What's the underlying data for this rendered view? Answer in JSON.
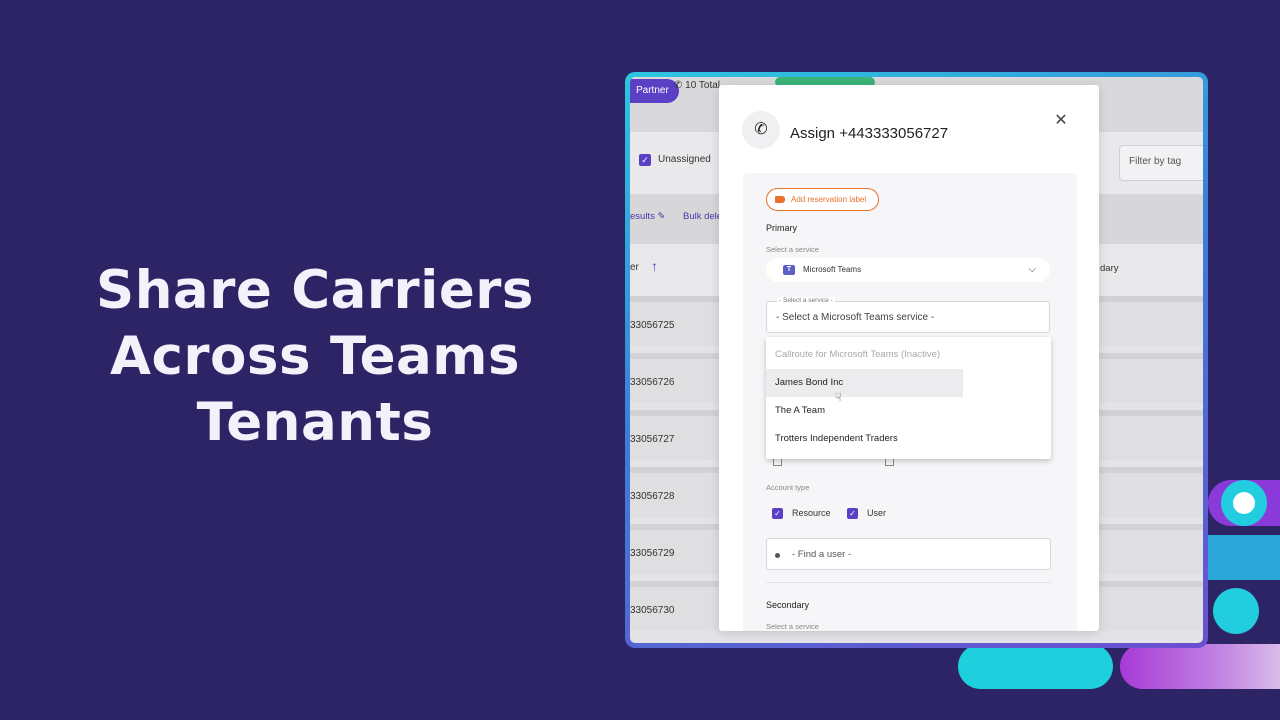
{
  "headline": [
    "Share Carriers",
    "Across Teams",
    "Tenants"
  ],
  "background": {
    "partner_tag": "Partner",
    "total": "10 Total",
    "unassigned_label": "Unassigned",
    "filter_placeholder": "Filter by tag",
    "results_label": "esults",
    "bulk_label": "Bulk dele",
    "header_col": "er",
    "header_secondary": "dary",
    "rows": [
      "33056725",
      "33056726",
      "33056727",
      "33056728",
      "33056729",
      "33056730"
    ]
  },
  "modal": {
    "title": "Assign +443333056727",
    "reservation_label": "Add reservation label",
    "primary_title": "Primary",
    "select_service_caption": "Select a service",
    "service_value": "Microsoft Teams",
    "sub_select_legend": "Select a service",
    "sub_select_value": "- Select a Microsoft Teams service -",
    "options": [
      {
        "label": "Callroute for Microsoft Teams (Inactive)",
        "disabled": true
      },
      {
        "label": "James Bond Inc",
        "disabled": false
      },
      {
        "label": "The A Team",
        "disabled": false
      },
      {
        "label": "Trotters Independent Traders",
        "disabled": false
      }
    ],
    "account_type_title": "Account type",
    "account_types": [
      "Resource",
      "User"
    ],
    "find_user_placeholder": "- Find a user -",
    "secondary_title": "Secondary",
    "secondary_caption": "Select a service"
  },
  "colors": {
    "background": "#2d2466",
    "accent": "#5b3fc4",
    "orange": "#e8722c",
    "teal": "#22cde0"
  }
}
